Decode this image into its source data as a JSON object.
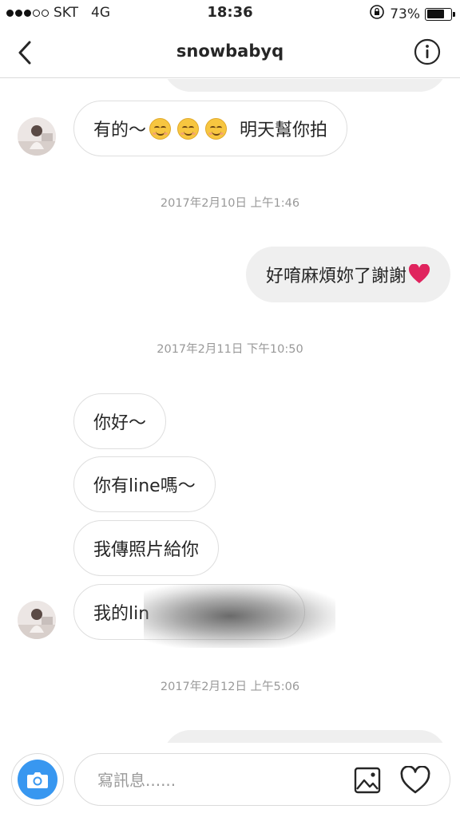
{
  "status_bar": {
    "carrier": "SKT",
    "network": "4G",
    "time": "18:36",
    "battery": "73%",
    "battery_level": 0.73
  },
  "header": {
    "title": "snowbabyq",
    "back_icon": "chevron-left-icon",
    "info_icon": "info-icon"
  },
  "messages": {
    "m1": {
      "text": "有的～",
      "suffix": "明天幫你拍",
      "emoji": "relieved-face-emoji"
    },
    "t1": "2017年2月10日 上午1:46",
    "m2": {
      "text": "好唷麻煩妳了謝謝",
      "emoji": "red-heart-emoji"
    },
    "t2": "2017年2月11日 下午10:50",
    "m3": "你好～",
    "m4": "你有line嗎～",
    "m5": "我傳照片給你",
    "m6": "我的lin",
    "t3": "2017年2月12日 上午5:06"
  },
  "input_bar": {
    "placeholder": "寫訊息......",
    "camera_icon": "camera-icon",
    "gallery_icon": "image-gallery-icon",
    "heart_icon": "heart-icon"
  },
  "colors": {
    "accent": "#3897f0",
    "sent_bubble": "#efefef",
    "border": "#dbdbdb",
    "timestamp": "#999999",
    "heart_emoji": "#e0245e"
  }
}
